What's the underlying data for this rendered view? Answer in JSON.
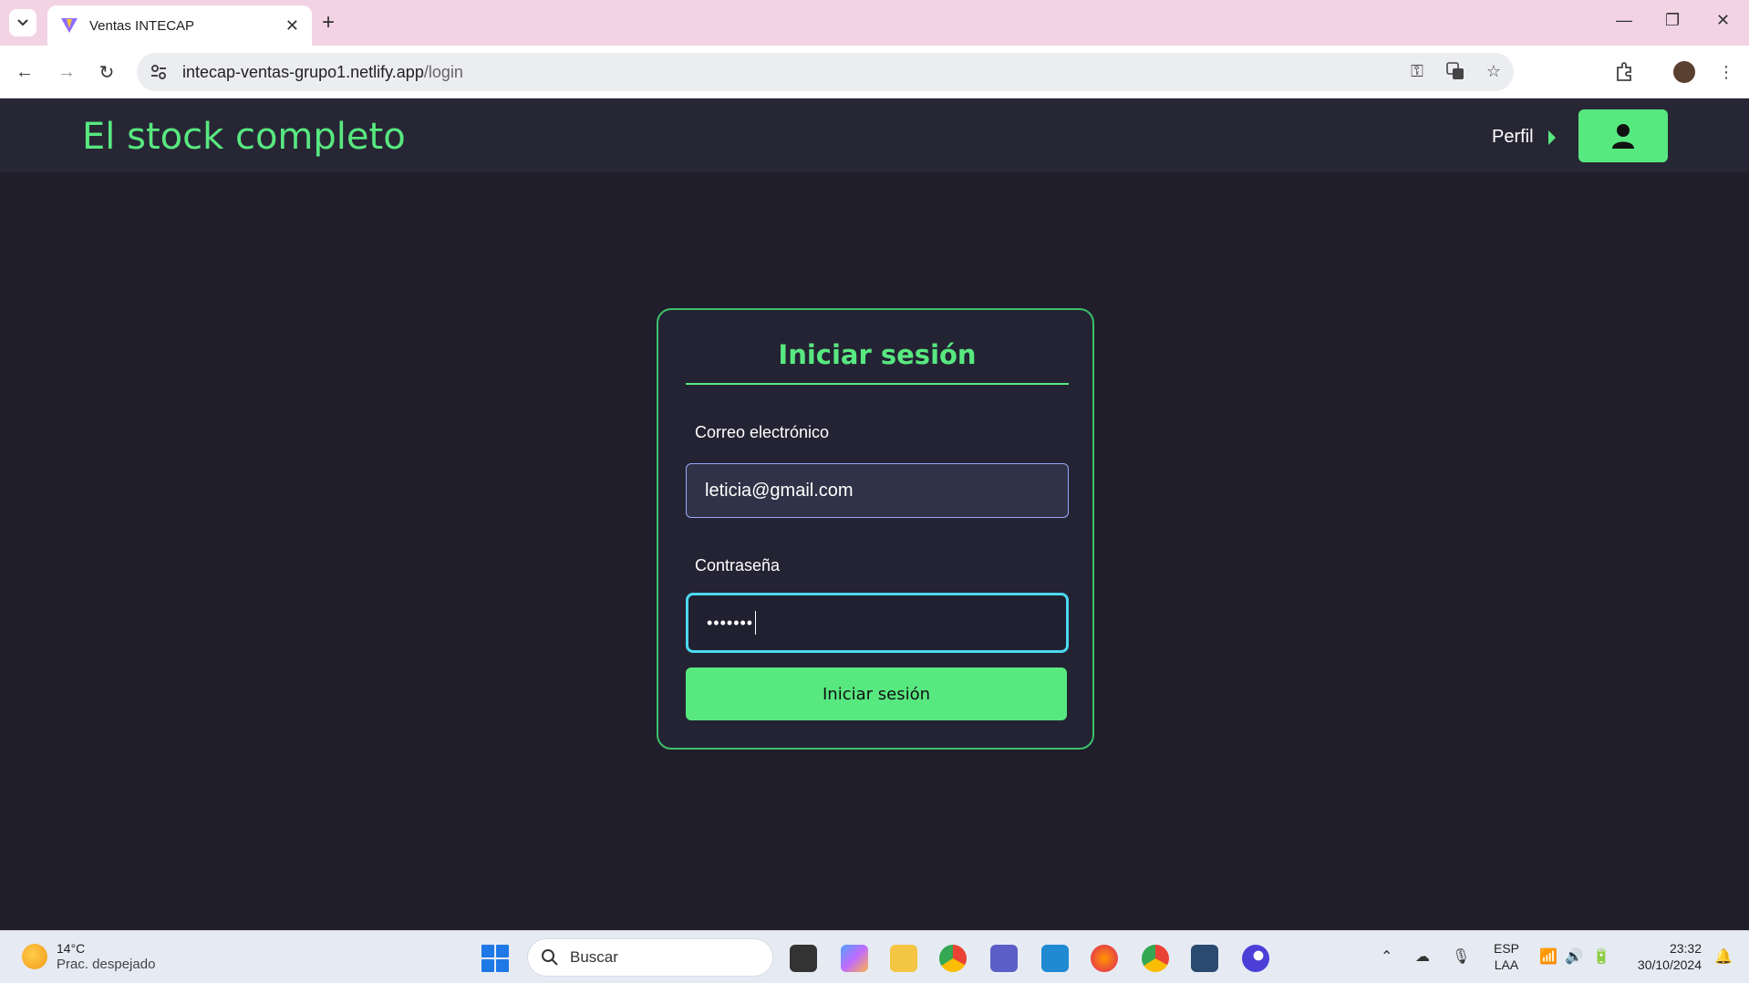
{
  "browser": {
    "tab_title": "Ventas INTECAP",
    "tab_close": "✕",
    "new_tab": "+",
    "url_host": "intecap-ventas-grupo1.netlify.app",
    "url_path": "/login"
  },
  "app": {
    "brand": "El stock completo",
    "profile_label": "Perfil"
  },
  "login": {
    "title": "Iniciar sesión",
    "email_label": "Correo electrónico",
    "email_value": "leticia@gmail.com",
    "password_label": "Contraseña",
    "password_masked": "•••••••",
    "submit_label": "Iniciar sesión"
  },
  "taskbar": {
    "weather_temp": "14°C",
    "weather_desc": "Prac. despejado",
    "search_label": "Buscar",
    "lang_top": "ESP",
    "lang_bottom": "LAA",
    "time": "23:32",
    "date": "30/10/2024"
  },
  "colors": {
    "accent": "#58e880",
    "background": "#201e2a",
    "nav": "#272635",
    "focus": "#4bd8f0"
  }
}
